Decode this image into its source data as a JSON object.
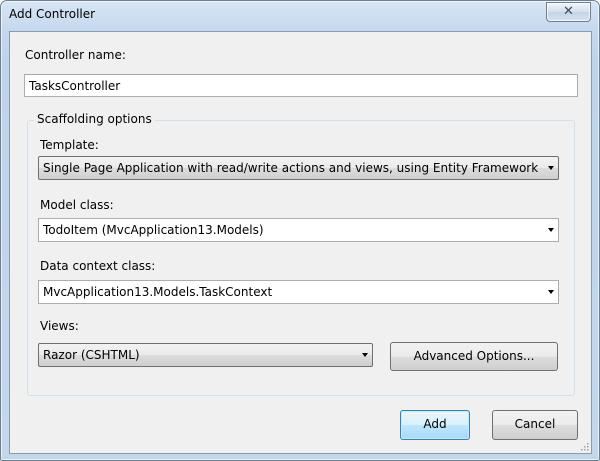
{
  "window": {
    "title": "Add Controller",
    "close_glyph": "✕"
  },
  "controller_name": {
    "label": "Controller name:",
    "value": "TasksController"
  },
  "scaffolding": {
    "group_title": "Scaffolding options",
    "template": {
      "label": "Template:",
      "value": "Single Page Application with read/write actions and views, using Entity Framework"
    },
    "model_class": {
      "label": "Model class:",
      "value": "TodoItem (MvcApplication13.Models)"
    },
    "data_context": {
      "label": "Data context class:",
      "value": "MvcApplication13.Models.TaskContext"
    },
    "views": {
      "label": "Views:",
      "value": "Razor (CSHTML)"
    },
    "advanced_label": "Advanced Options..."
  },
  "buttons": {
    "add": "Add",
    "cancel": "Cancel"
  },
  "icons": {
    "close": "close-icon",
    "dropdown": "chevron-down-icon",
    "resize": "resize-grip-icon"
  }
}
